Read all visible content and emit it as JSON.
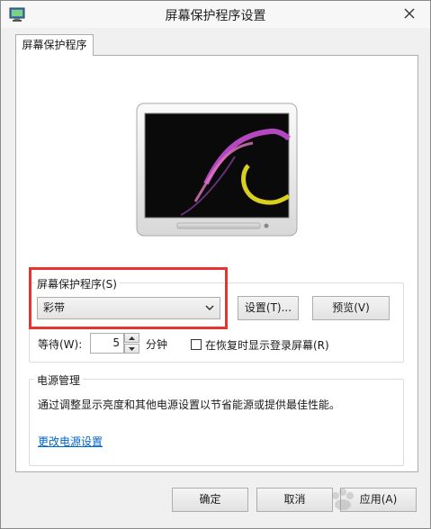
{
  "window": {
    "title": "屏幕保护程序设置"
  },
  "tabs": [
    {
      "label": "屏幕保护程序",
      "active": true
    }
  ],
  "screensaver": {
    "group_label": "屏幕保护程序(S)",
    "selected": "彩带",
    "settings_button": "设置(T)...",
    "preview_button": "预览(V)",
    "wait_label": "等待(W):",
    "wait_value": "5",
    "wait_unit": "分钟",
    "resume_checkbox_label": "在恢复时显示登录屏幕(R)",
    "resume_checked": false
  },
  "power": {
    "group_label": "电源管理",
    "description": "通过调整显示亮度和其他电源设置以节省能源或提供最佳性能。",
    "link": "更改电源设置"
  },
  "footer": {
    "ok": "确定",
    "cancel": "取消",
    "apply": "应用(A)"
  },
  "colors": {
    "highlight": "#e8332f",
    "link": "#0066cc"
  }
}
